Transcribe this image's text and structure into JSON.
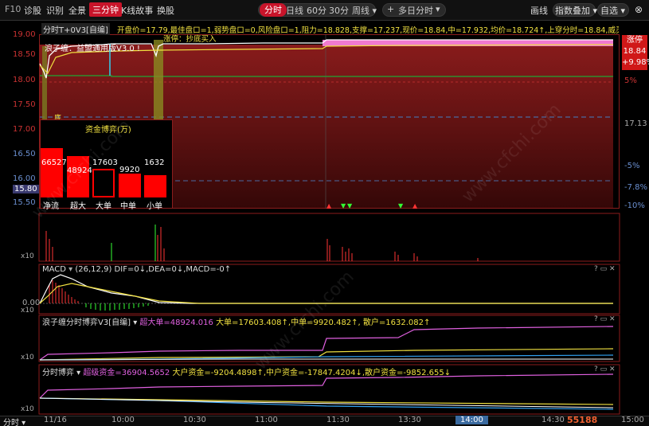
{
  "toolbar": {
    "items": [
      "F10",
      "诊股",
      "识别",
      "全景",
      "三分钟",
      "K线故事",
      "换股"
    ],
    "active": "三分钟",
    "periods": [
      "分时",
      "日线",
      "60分",
      "30分",
      "周线 ▾"
    ],
    "active_period": "分时",
    "multiday": "多日分时",
    "right": [
      "画线",
      "指数叠加 ▾",
      "自选 ▾"
    ]
  },
  "main": {
    "header_left": "分时",
    "header_right": "T+0V3[自编]",
    "indicator_text": "开盘价=17.79,最佳盘口=1,弱势盘口=0,风险盘口=1,阻力=18.828,支撑=17.237,现价=18.84,中=17.932,均价=18.724↑,上穿分时=18.84,威灵=18.",
    "left_axis": [
      "19.00",
      "18.50",
      "18.00",
      "17.50",
      "17.00",
      "16.50",
      "16.00",
      "15.80",
      "15.50"
    ],
    "right_axis": [
      "5%",
      "17.13",
      "-5%",
      "-7.8%",
      "-10%"
    ],
    "limit_label": "涨停",
    "limit_price": "18.84",
    "limit_pct": "+9.98%",
    "banner": "浪子缠：益盟通用版V3.0 !",
    "buy_text": "涨停：抄底买入",
    "low_marker": "底",
    "x10": "x10"
  },
  "fund_box": {
    "title": "资金博弈(万)",
    "bars": [
      {
        "value": "66527",
        "label": "净流",
        "height": 0.95,
        "solid": true
      },
      {
        "value": "48924",
        "label": "超大",
        "height": 0.7,
        "solid": true
      },
      {
        "value": "17603",
        "label": "大单",
        "height": 0.48,
        "solid": false
      },
      {
        "value": "9920",
        "label": "中单",
        "height": 0.36,
        "solid": true
      },
      {
        "value": "1632",
        "label": "小单",
        "height": 0.39,
        "solid": true
      }
    ]
  },
  "macd": {
    "title": "MACD",
    "params": "(26,12,9)",
    "text": "DIF=0↓,DEA=0↓,MACD=-0↑",
    "zero": "0.00",
    "scale": "x10"
  },
  "panel3": {
    "title": "浪子缠分时博弈V3[自编]",
    "text1": "超大单=48924.016",
    "text2": "大单=17603.408↑,中单=9920.482↑,",
    "text3": "散户=1632.082↑",
    "scale": "x10"
  },
  "panel4": {
    "title": "分时博弈",
    "text1": "超级资金=36904.5652",
    "text2": "大户资金=-9204.4898↑,中户资金=-17847.4204↓,散户资金=-9852.655↓",
    "scale": "x10"
  },
  "time_axis": {
    "left": "分时",
    "ticks": [
      "11/16",
      "10:00",
      "10:30",
      "11:00",
      "11:30",
      "13:30",
      "14:00",
      "14:30",
      "15:00"
    ]
  },
  "watermark": "www.cfchi.com",
  "corner_mark": "55188"
}
